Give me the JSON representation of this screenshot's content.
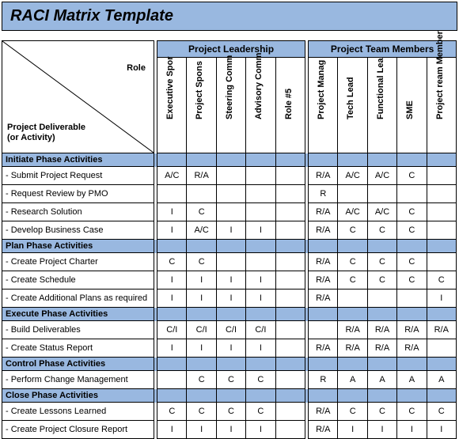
{
  "title": "RACI Matrix Template",
  "cornerRole": "Role",
  "cornerDeliverable": "Project Deliverable\n(or Activity)",
  "groups": [
    "Project Leadership",
    "Project Team Members"
  ],
  "roles": [
    "Executive Spor",
    "Project Spons",
    "Steering Comm",
    "Advisory Comm",
    "Role #5",
    "Project Manag",
    "Tech Lead",
    "Functional Lea",
    "SME",
    "Project ream\nMember"
  ],
  "chart_data": {
    "type": "table",
    "title": "RACI Matrix Template",
    "columns": [
      "Executive Spor",
      "Project Spons",
      "Steering Comm",
      "Advisory Comm",
      "Role #5",
      "Project Manag",
      "Tech Lead",
      "Functional Lea",
      "SME",
      "Project ream Member"
    ],
    "sections": [
      {
        "phase": "Initiate Phase Activities",
        "rows": [
          {
            "activity": " - Submit Project Request",
            "v": [
              "A/C",
              "R/A",
              "",
              "",
              "",
              "R/A",
              "A/C",
              "A/C",
              "C",
              ""
            ]
          },
          {
            "activity": " - Request Review by PMO",
            "v": [
              "",
              "",
              "",
              "",
              "",
              "R",
              "",
              "",
              "",
              ""
            ]
          },
          {
            "activity": " - Research Solution",
            "v": [
              "I",
              "C",
              "",
              "",
              "",
              "R/A",
              "A/C",
              "A/C",
              "C",
              ""
            ]
          },
          {
            "activity": " - Develop Business Case",
            "v": [
              "I",
              "A/C",
              "I",
              "I",
              "",
              "R/A",
              "C",
              "C",
              "C",
              ""
            ]
          }
        ]
      },
      {
        "phase": "Plan Phase Activities",
        "rows": [
          {
            "activity": " - Create Project Charter",
            "v": [
              "C",
              "C",
              "",
              "",
              "",
              "R/A",
              "C",
              "C",
              "C",
              ""
            ]
          },
          {
            "activity": " - Create Schedule",
            "v": [
              "I",
              "I",
              "I",
              "I",
              "",
              "R/A",
              "C",
              "C",
              "C",
              "C"
            ]
          },
          {
            "activity": " - Create Additional Plans as required",
            "v": [
              "I",
              "I",
              "I",
              "I",
              "",
              "R/A",
              "",
              "",
              "",
              "I"
            ]
          }
        ]
      },
      {
        "phase": "Execute Phase Activities",
        "rows": [
          {
            "activity": " - Build Deliverables",
            "v": [
              "C/I",
              "C/I",
              "C/I",
              "C/I",
              "",
              "",
              "R/A",
              "R/A",
              "R/A",
              "R/A"
            ]
          },
          {
            "activity": " - Create Status Report",
            "v": [
              "I",
              "I",
              "I",
              "I",
              "",
              "R/A",
              "R/A",
              "R/A",
              "R/A",
              ""
            ]
          }
        ]
      },
      {
        "phase": "Control Phase Activities",
        "rows": [
          {
            "activity": " - Perform Change Management",
            "v": [
              "",
              "C",
              "C",
              "C",
              "",
              "R",
              "A",
              "A",
              "A",
              "A"
            ]
          }
        ]
      },
      {
        "phase": "Close Phase Activities",
        "rows": [
          {
            "activity": " - Create Lessons Learned",
            "v": [
              "C",
              "C",
              "C",
              "C",
              "",
              "R/A",
              "C",
              "C",
              "C",
              "C"
            ]
          },
          {
            "activity": " - Create Project Closure Report",
            "v": [
              "I",
              "I",
              "I",
              "I",
              "",
              "R/A",
              "I",
              "I",
              "I",
              "I"
            ]
          }
        ]
      }
    ]
  }
}
